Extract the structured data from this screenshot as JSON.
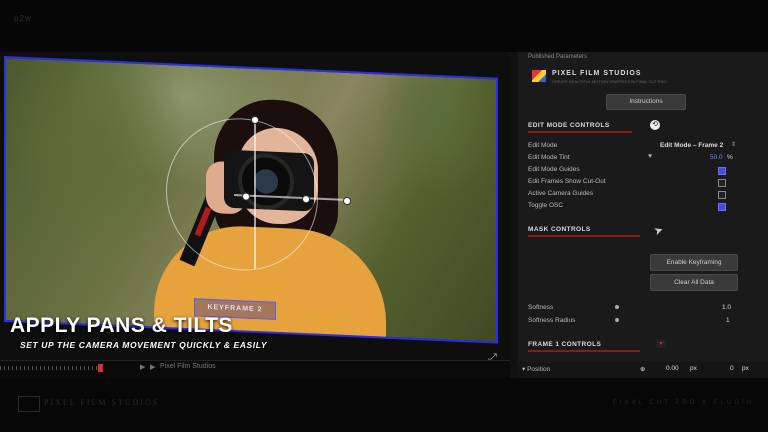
{
  "header": {
    "label": "p2w"
  },
  "overlay": {
    "title": "APPLY PANS & TILTS",
    "subtitle": "SET UP THE CAMERA MOVEMENT QUICKLY & EASILY",
    "keyframe_label": "KEYFRAME 2"
  },
  "timeline": {
    "label": "Pixel Film Studios"
  },
  "panel": {
    "header": "Published Parameters",
    "brand": "PIXEL FILM STUDIOS",
    "brand_tagline": "CREATE BEAUTIFUL MOTION GRAPHICS IN FINAL CUT PRO",
    "instructions_button": "Instructions",
    "edit_mode_section": "EDIT MODE CONTROLS",
    "rows": {
      "edit_mode": {
        "label": "Edit Mode",
        "value": "Edit Mode – Frame 2"
      },
      "edit_mode_tint": {
        "label": "Edit Mode Tint",
        "value": "50.0",
        "unit": "%"
      },
      "edit_mode_guides": {
        "label": "Edit Mode Guides",
        "checked": true
      },
      "edit_frames_cutout": {
        "label": "Edit Frames Show Cut-Out",
        "checked": false
      },
      "active_camera_guides": {
        "label": "Active Camera Guides",
        "checked": false
      },
      "toggle_osc": {
        "label": "Toggle OSC",
        "checked": true
      }
    },
    "mask_section": "MASK CONTROLS",
    "enable_keyframing_button": "Enable Keyframing",
    "clear_all_button": "Clear All Data",
    "softness": {
      "label": "Softness",
      "value": "1.0"
    },
    "softness_radius": {
      "label": "Softness Radius",
      "value": "1"
    },
    "frame_section": "FRAME 1 CONTROLS",
    "position": {
      "label": "Position",
      "x": "0.00",
      "x_unit": "px",
      "y": "0",
      "y_unit": "px"
    }
  },
  "footer": {
    "brand": "PIXEL FILM STUDIOS",
    "right": "FINAL CUT PRO X PLUGIN"
  },
  "colors": {
    "accent_blue": "#4a4ad8",
    "section_red": "#8b1a1a",
    "frame_border": "#2d2de8"
  }
}
